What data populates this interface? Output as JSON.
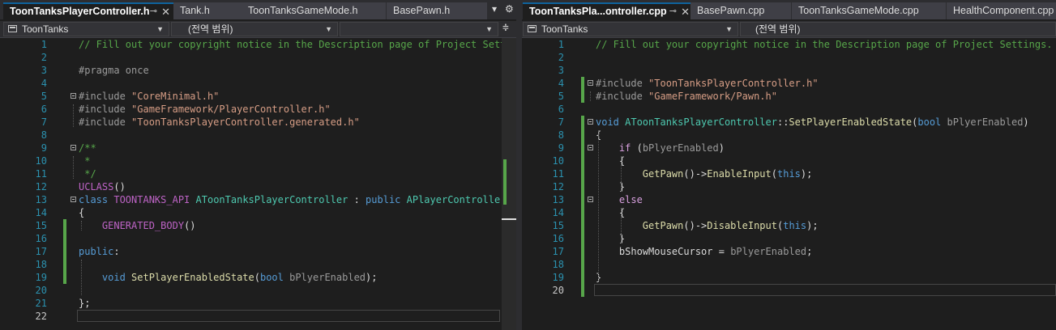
{
  "left_tabs": [
    {
      "label": "ToonTanksPlayerController.h",
      "active": true
    },
    {
      "label": "Tank.h",
      "active": false
    },
    {
      "label": "ToonTanksGameMode.h",
      "active": false
    },
    {
      "label": "BasePawn.h",
      "active": false
    }
  ],
  "right_tabs": [
    {
      "label": "ToonTanksPla...ontroller.cpp",
      "active": true
    },
    {
      "label": "BasePawn.cpp",
      "active": false
    },
    {
      "label": "ToonTanksGameMode.cpp",
      "active": false
    },
    {
      "label": "HealthComponent.cpp",
      "active": false
    }
  ],
  "tab_controls": {
    "pin": "⊸",
    "close": "✕",
    "dropdown": "▾",
    "settings": "⚙"
  },
  "left_nav": {
    "project": "ToonTanks",
    "scope": "(전역 범위)",
    "split": "≑"
  },
  "right_nav": {
    "project": "ToonTanks",
    "scope": "(전역 범위)"
  },
  "colors": {
    "background": "#1e1e1e",
    "keyword": "#569cd6",
    "string": "#d69d85",
    "comment": "#57a64a",
    "type": "#4ec9b0",
    "function": "#dcdcaa",
    "line_number": "#2b91af",
    "change_marker": "#57a64a"
  },
  "left_code": {
    "current_line": 22,
    "lines": [
      {
        "n": "1",
        "t": [
          [
            "cm",
            "// Fill out your copyright notice in the Description page of Project Settings."
          ]
        ]
      },
      {
        "n": "2",
        "t": []
      },
      {
        "n": "3",
        "t": [
          [
            "pp",
            "#pragma once"
          ]
        ]
      },
      {
        "n": "4",
        "t": []
      },
      {
        "n": "5",
        "t": [
          [
            "pp",
            "#include "
          ],
          [
            "str",
            "\"CoreMinimal.h\""
          ]
        ]
      },
      {
        "n": "6",
        "t": [
          [
            "pp",
            "#include "
          ],
          [
            "str",
            "\"GameFramework/PlayerController.h\""
          ]
        ]
      },
      {
        "n": "7",
        "t": [
          [
            "pp",
            "#include "
          ],
          [
            "str",
            "\"ToonTanksPlayerController.generated.h\""
          ]
        ]
      },
      {
        "n": "8",
        "t": []
      },
      {
        "n": "9",
        "t": [
          [
            "cm",
            "/**"
          ]
        ]
      },
      {
        "n": "10",
        "t": [
          [
            "cm",
            " *"
          ]
        ]
      },
      {
        "n": "11",
        "t": [
          [
            "cm",
            " */"
          ]
        ]
      },
      {
        "n": "12",
        "t": [
          [
            "mac",
            "UCLASS"
          ],
          [
            "txt",
            "()"
          ]
        ]
      },
      {
        "n": "13",
        "t": [
          [
            "kw",
            "class "
          ],
          [
            "mac",
            "TOONTANKS_API "
          ],
          [
            "ty",
            "AToonTanksPlayerController"
          ],
          [
            "txt",
            " : "
          ],
          [
            "kw",
            "public "
          ],
          [
            "ty",
            "APlayerController"
          ]
        ]
      },
      {
        "n": "14",
        "t": [
          [
            "txt",
            "{"
          ]
        ]
      },
      {
        "n": "15",
        "t": [
          [
            "txt",
            "    "
          ],
          [
            "mac",
            "GENERATED_BODY"
          ],
          [
            "txt",
            "()"
          ]
        ]
      },
      {
        "n": "16",
        "t": []
      },
      {
        "n": "17",
        "t": [
          [
            "kw",
            "public"
          ],
          [
            "txt",
            ":"
          ]
        ]
      },
      {
        "n": "18",
        "t": []
      },
      {
        "n": "19",
        "t": [
          [
            "txt",
            "    "
          ],
          [
            "kw",
            "void "
          ],
          [
            "fn",
            "SetPlayerEnabledState"
          ],
          [
            "txt",
            "("
          ],
          [
            "kw",
            "bool "
          ],
          [
            "param",
            "bPlyerEnabled"
          ],
          [
            "txt",
            ");"
          ]
        ]
      },
      {
        "n": "20",
        "t": []
      },
      {
        "n": "21",
        "t": [
          [
            "txt",
            "};"
          ]
        ]
      },
      {
        "n": "22",
        "t": []
      }
    ]
  },
  "right_code": {
    "current_line": 20,
    "lines": [
      {
        "n": "1",
        "t": [
          [
            "cm",
            "// Fill out your copyright notice in the Description page of Project Settings."
          ]
        ]
      },
      {
        "n": "2",
        "t": []
      },
      {
        "n": "3",
        "t": []
      },
      {
        "n": "4",
        "t": [
          [
            "pp",
            "#include "
          ],
          [
            "str",
            "\"ToonTanksPlayerController.h\""
          ]
        ]
      },
      {
        "n": "5",
        "t": [
          [
            "pp",
            "#include "
          ],
          [
            "str",
            "\"GameFramework/Pawn.h\""
          ]
        ]
      },
      {
        "n": "6",
        "t": []
      },
      {
        "n": "7",
        "t": [
          [
            "kw",
            "void "
          ],
          [
            "ty",
            "AToonTanksPlayerController"
          ],
          [
            "txt",
            "::"
          ],
          [
            "fn",
            "SetPlayerEnabledState"
          ],
          [
            "txt",
            "("
          ],
          [
            "kw",
            "bool "
          ],
          [
            "param",
            "bPlyerEnabled"
          ],
          [
            "txt",
            ")"
          ]
        ]
      },
      {
        "n": "8",
        "t": [
          [
            "txt",
            "{"
          ]
        ]
      },
      {
        "n": "9",
        "t": [
          [
            "txt",
            "    "
          ],
          [
            "kwc",
            "if "
          ],
          [
            "txt",
            "("
          ],
          [
            "param",
            "bPlyerEnabled"
          ],
          [
            "txt",
            ")"
          ]
        ]
      },
      {
        "n": "10",
        "t": [
          [
            "txt",
            "    {"
          ]
        ]
      },
      {
        "n": "11",
        "t": [
          [
            "txt",
            "        "
          ],
          [
            "fn",
            "GetPawn"
          ],
          [
            "txt",
            "()->"
          ],
          [
            "fn",
            "EnableInput"
          ],
          [
            "txt",
            "("
          ],
          [
            "kw",
            "this"
          ],
          [
            "txt",
            ");"
          ]
        ]
      },
      {
        "n": "12",
        "t": [
          [
            "txt",
            "    }"
          ]
        ]
      },
      {
        "n": "13",
        "t": [
          [
            "txt",
            "    "
          ],
          [
            "kwc",
            "else"
          ]
        ]
      },
      {
        "n": "14",
        "t": [
          [
            "txt",
            "    {"
          ]
        ]
      },
      {
        "n": "15",
        "t": [
          [
            "txt",
            "        "
          ],
          [
            "fn",
            "GetPawn"
          ],
          [
            "txt",
            "()->"
          ],
          [
            "fn",
            "DisableInput"
          ],
          [
            "txt",
            "("
          ],
          [
            "kw",
            "this"
          ],
          [
            "txt",
            ");"
          ]
        ]
      },
      {
        "n": "16",
        "t": [
          [
            "txt",
            "    }"
          ]
        ]
      },
      {
        "n": "17",
        "t": [
          [
            "txt",
            "    "
          ],
          [
            "mem",
            "bShowMouseCursor"
          ],
          [
            "txt",
            " = "
          ],
          [
            "param",
            "bPlyerEnabled"
          ],
          [
            "txt",
            ";"
          ]
        ]
      },
      {
        "n": "18",
        "t": []
      },
      {
        "n": "19",
        "t": [
          [
            "txt",
            "}"
          ]
        ]
      },
      {
        "n": "20",
        "t": []
      }
    ]
  }
}
